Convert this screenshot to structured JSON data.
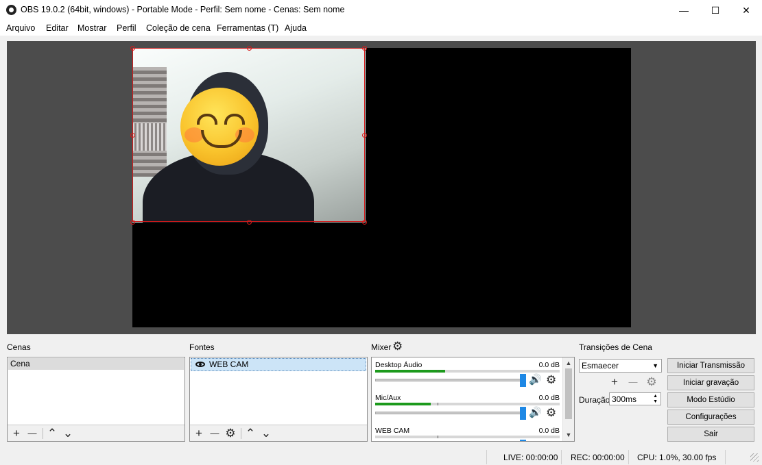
{
  "window": {
    "title": "OBS 19.0.2 (64bit, windows) - Portable Mode - Perfil: Sem nome - Cenas: Sem nome",
    "minimize": "—",
    "maximize": "☐",
    "close": "✕"
  },
  "menu": [
    "Arquivo",
    "Editar",
    "Mostrar",
    "Perfil",
    "Coleção de cena",
    "Ferramentas (T)",
    "Ajuda"
  ],
  "scenes": {
    "label": "Cenas",
    "items": [
      "Cena"
    ]
  },
  "sources": {
    "label": "Fontes",
    "items": [
      {
        "name": "WEB CAM",
        "visible": true,
        "selected": true
      }
    ]
  },
  "mixer": {
    "label": "Mixer",
    "channels": [
      {
        "name": "Desktop Áudio",
        "db": "0.0 dB",
        "level": 0.38,
        "volume": 1.0
      },
      {
        "name": "Mic/Aux",
        "db": "0.0 dB",
        "level": 0.3,
        "volume": 1.0
      },
      {
        "name": "WEB CAM",
        "db": "0.0 dB",
        "level": 0.0,
        "volume": 1.0
      }
    ]
  },
  "transitions": {
    "label": "Transições de Cena",
    "selected": "Esmaecer",
    "duration_label": "Duração",
    "duration_value": "300ms"
  },
  "controls": {
    "start_stream": "Iniciar Transmissão",
    "start_record": "Iniciar gravação",
    "studio_mode": "Modo Estúdio",
    "settings": "Configurações",
    "exit": "Sair"
  },
  "status": {
    "live": "LIVE: 00:00:00",
    "rec": "REC: 00:00:00",
    "cpu": "CPU: 1.0%, 30.00 fps"
  },
  "icons": {
    "add": "+",
    "remove": "—",
    "up": "⌃",
    "down": "⌄",
    "gear": "⚙",
    "speaker": "🔊",
    "dropdown": "▼"
  },
  "colors": {
    "selection": "#d41a1a",
    "meter": "#1c9a1c",
    "slider": "#1e88e5"
  }
}
